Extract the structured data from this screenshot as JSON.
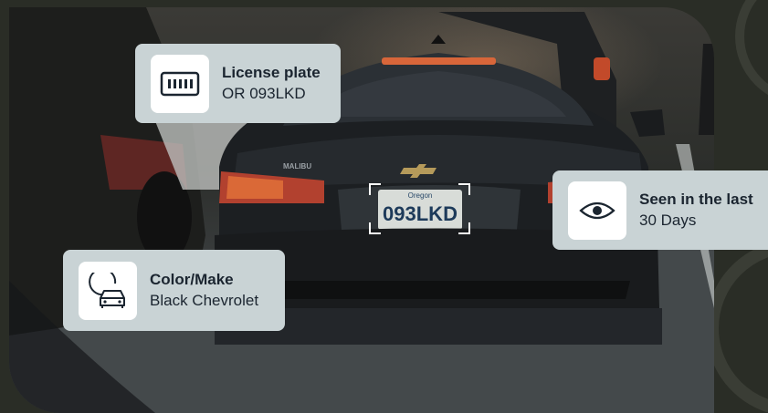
{
  "cards": {
    "license_plate": {
      "title": "License plate",
      "value": "OR 093LKD",
      "icon": "license-plate-icon"
    },
    "seen": {
      "title": "Seen in the last",
      "value": "30 Days",
      "icon": "eye-icon"
    },
    "color_make": {
      "title": "Color/Make",
      "value": "Black Chevrolet",
      "icon": "car-color-icon"
    }
  },
  "photo": {
    "plate_state": "Oregon",
    "plate_text": "093LKD",
    "car_badge": "MALIBU"
  },
  "colors": {
    "background": "#2a2d26",
    "card": "#c9d3d5",
    "icon_box": "#ffffff",
    "text": "#1b2530"
  }
}
